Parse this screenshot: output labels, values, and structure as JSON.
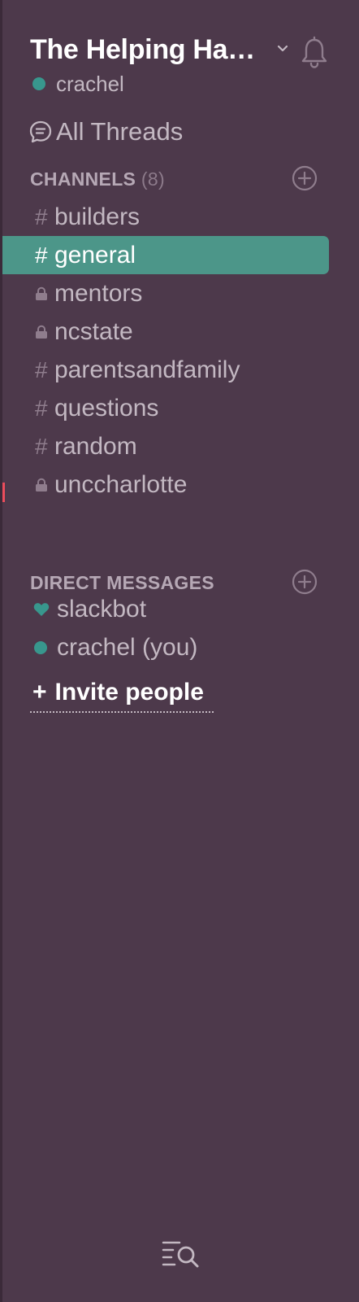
{
  "team": {
    "name": "The Helping Ha…",
    "user": "crachel"
  },
  "all_threads": {
    "label": "All Threads"
  },
  "channels": {
    "title": "CHANNELS",
    "count": "(8)",
    "items": [
      {
        "name": "builders",
        "type": "public"
      },
      {
        "name": "general",
        "type": "public",
        "active": true
      },
      {
        "name": "mentors",
        "type": "private"
      },
      {
        "name": "ncstate",
        "type": "private"
      },
      {
        "name": "parentsandfamily",
        "type": "public"
      },
      {
        "name": "questions",
        "type": "public"
      },
      {
        "name": "random",
        "type": "public"
      },
      {
        "name": "unccharlotte",
        "type": "private"
      }
    ],
    "public_prefix": "#"
  },
  "direct_messages": {
    "title": "DIRECT MESSAGES",
    "items": [
      {
        "name": "slackbot",
        "status_icon": "heart-icon"
      },
      {
        "name": "crachel (you)",
        "status_icon": "presence-dot-icon"
      }
    ]
  },
  "invite": {
    "plus": "+",
    "label": "Invite people"
  },
  "icons": {
    "team_menu": "chevron-down-icon",
    "notifications": "bell-icon",
    "threads": "threads-icon",
    "add": "add-circle-icon",
    "private": "lock-icon",
    "quick_switcher": "quick-switcher-icon"
  },
  "colors": {
    "sidebar_bg": "#4d394b",
    "active_channel": "#4c9689",
    "presence": "#38978d",
    "unread_marker": "#eb4d5c",
    "text_muted": "#c3b8c2"
  }
}
